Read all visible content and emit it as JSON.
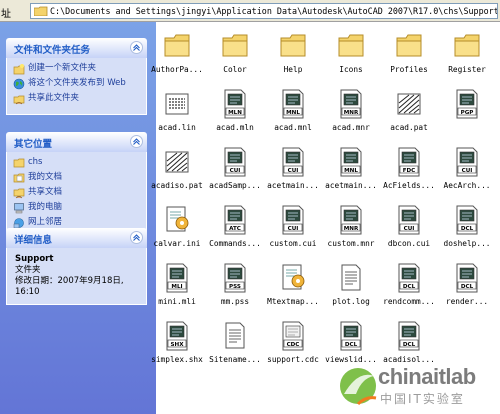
{
  "address": {
    "label": "址",
    "path": "C:\\Documents and Settings\\jingyi\\Application Data\\Autodesk\\AutoCAD 2007\\R17.0\\chs\\Support"
  },
  "panels": {
    "tasks": {
      "title": "文件和文件夹任务",
      "items": [
        "创建一个新文件夹",
        "将这个文件夹发布到 Web",
        "共享此文件夹"
      ]
    },
    "places": {
      "title": "其它位置",
      "items": [
        "chs",
        "我的文档",
        "共享文档",
        "我的电脑",
        "网上邻居"
      ]
    },
    "details": {
      "title": "详细信息",
      "name": "Support",
      "type": "文件夹",
      "modified_label": "修改日期：",
      "modified_date": "2007年9月18日,",
      "modified_time": "16:10"
    }
  },
  "files": [
    {
      "name": "AuthorPa...",
      "icon": "folder"
    },
    {
      "name": "Color",
      "icon": "folder"
    },
    {
      "name": "Help",
      "icon": "folder"
    },
    {
      "name": "Icons",
      "icon": "folder"
    },
    {
      "name": "Profiles",
      "icon": "folder"
    },
    {
      "name": "Register",
      "icon": "folder"
    },
    {
      "name": "acad.lin",
      "icon": "lin"
    },
    {
      "name": "acad.mln",
      "icon": "doc",
      "badge": "MLN"
    },
    {
      "name": "acad.mnl",
      "icon": "doc",
      "badge": "MNL"
    },
    {
      "name": "acad.mnr",
      "icon": "doc",
      "badge": "MNR"
    },
    {
      "name": "acad.pat",
      "icon": "pat"
    },
    {
      "name": "",
      "icon": "doc",
      "badge": "PGP"
    },
    {
      "name": "acadiso.pat",
      "icon": "pat"
    },
    {
      "name": "acadSamp...",
      "icon": "doc",
      "badge": "CUI"
    },
    {
      "name": "acetmain...",
      "icon": "doc",
      "badge": "CUI"
    },
    {
      "name": "acetmain...",
      "icon": "doc",
      "badge": "MNL"
    },
    {
      "name": "AcFields...",
      "icon": "doc",
      "badge": "FDC"
    },
    {
      "name": "AecArch...",
      "icon": "doc",
      "badge": "CUI"
    },
    {
      "name": "calvar.ini",
      "icon": "ini"
    },
    {
      "name": "Commands...",
      "icon": "doc",
      "badge": "ATC"
    },
    {
      "name": "custom.cui",
      "icon": "doc",
      "badge": "CUI"
    },
    {
      "name": "custom.mnr",
      "icon": "doc",
      "badge": "MNR"
    },
    {
      "name": "dbcon.cui",
      "icon": "doc",
      "badge": "CUI"
    },
    {
      "name": "doshelp...",
      "icon": "doc",
      "badge": "DCL"
    },
    {
      "name": "mini.mli",
      "icon": "doc",
      "badge": "MLI"
    },
    {
      "name": "mm.pss",
      "icon": "doc",
      "badge": "PSS"
    },
    {
      "name": "Mtextmap...",
      "icon": "ini"
    },
    {
      "name": "plot.log",
      "icon": "txt"
    },
    {
      "name": "rendcomm...",
      "icon": "doc",
      "badge": "DCL"
    },
    {
      "name": "render...",
      "icon": "doc",
      "badge": "DCL"
    },
    {
      "name": "simplex.shx",
      "icon": "doc",
      "badge": "SHX"
    },
    {
      "name": "Sitename...",
      "icon": "txt"
    },
    {
      "name": "support.cdc",
      "icon": "cdc",
      "badge": "CDC"
    },
    {
      "name": "viewslid...",
      "icon": "doc",
      "badge": "DCL"
    },
    {
      "name": "acadisol...",
      "icon": "doc",
      "badge": "DCL"
    }
  ],
  "watermark": {
    "text": "chinaitlab",
    "sub": "中国IT实验室"
  },
  "colors": {
    "pane_gradient_top": "#7ba2e7",
    "pane_gradient_bottom": "#6375d6",
    "panel_title": "#215dc6",
    "panel_body": "#d6dff7",
    "folder": "#f4d36b"
  }
}
